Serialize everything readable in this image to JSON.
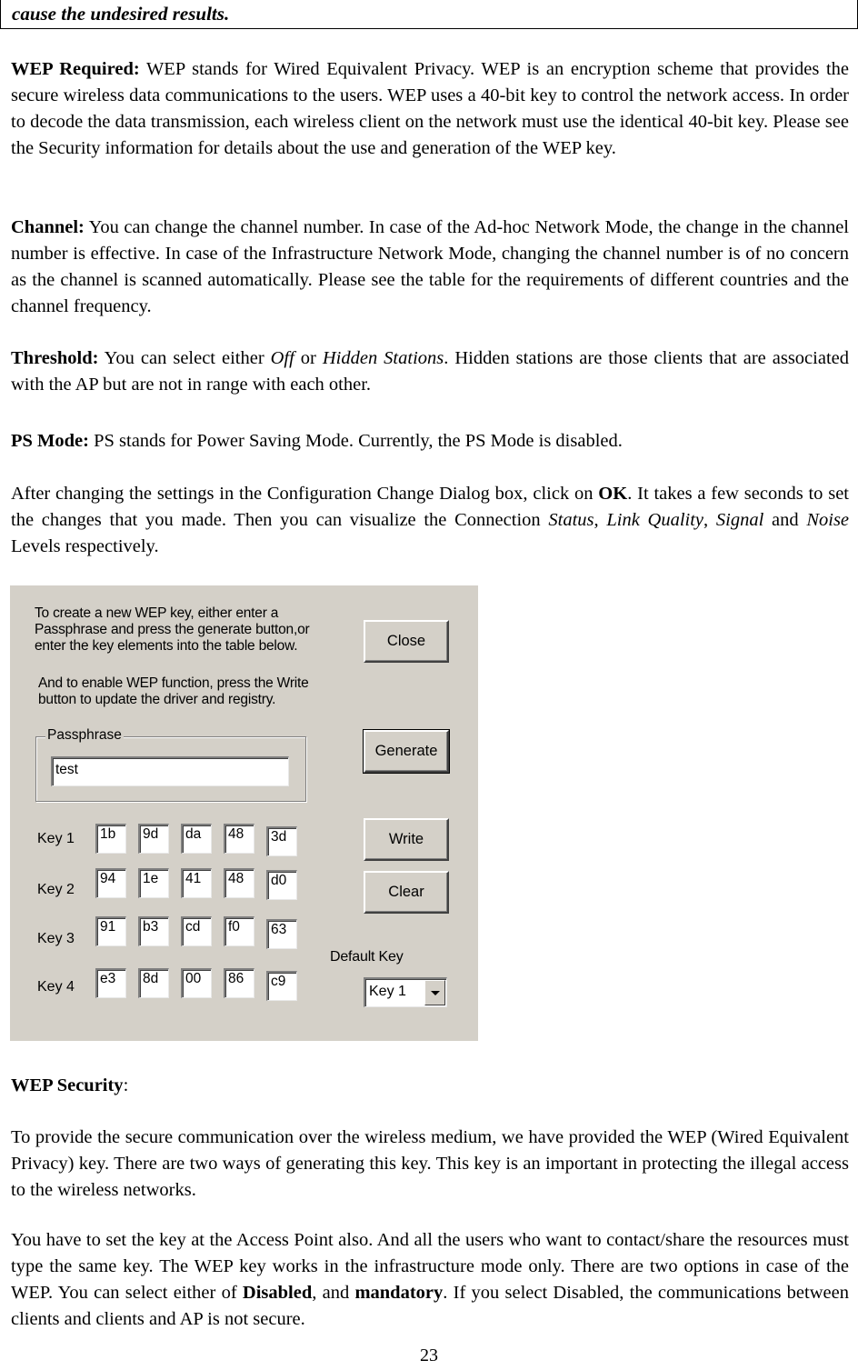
{
  "top_box": {
    "text": "cause the undesired results."
  },
  "sections": {
    "wep_required": {
      "heading": "WEP Required:",
      "text": " WEP stands for Wired Equivalent Privacy. WEP is an encryption scheme that provides the secure wireless data communications to the users. WEP uses a 40-bit key to control the network access. In order to decode the data transmission, each wireless client on the network must use the identical 40-bit key. Please see the Security information for details about the use and generation of the WEP key."
    },
    "channel": {
      "heading": "Channel:",
      "text": " You can change the channel number. In case of the Ad-hoc Network Mode, the change in the channel number is effective. In case of the Infrastructure Network Mode, changing the channel number is of no concern as the channel is scanned automatically. Please see the table for the requirements of different countries and the channel frequency."
    },
    "threshold": {
      "heading": "Threshold:",
      "text_1": " You can select either ",
      "opt_off": "Off",
      "text_2": " or ",
      "opt_hidden": "Hidden Stations",
      "text_3": ". Hidden stations are those clients that are associated with the AP but are not in range with each other."
    },
    "ps_mode": {
      "heading": "PS Mode:",
      "text": " PS stands for Power Saving Mode. Currently, the PS Mode is disabled."
    },
    "after_changing": {
      "text_1": "After changing the settings in the Configuration Change Dialog box, click on ",
      "ok": "OK",
      "text_2": ". It takes a few seconds to set the changes that you made. Then you can visualize the Connection ",
      "status": "Status",
      "sep1": ", ",
      "link_quality": "Link Quality",
      "sep2": ", ",
      "signal": "Signal",
      "text_3": " and ",
      "noise": "Noise",
      "text_4": " Levels respectively."
    },
    "wep_security": {
      "heading": "WEP Security",
      "colon": ":"
    },
    "wep_security_p1": {
      "text": "To provide the secure communication over the wireless medium, we have provided the WEP (Wired Equivalent Privacy) key. There are two ways of generating this key. This key is an important in protecting the illegal access to the wireless networks."
    },
    "wep_security_p2": {
      "text_1": "You have to set the key at the Access Point also. And all the users who want to contact/share the resources must type the same key. The WEP key works in the infrastructure mode only. There are two options in case of the WEP. You can select either of ",
      "disabled": "Disabled",
      "text_2": ", and ",
      "mandatory": "mandatory",
      "text_3": ". If you select Disabled, the communications between clients and clients and AP is not secure."
    }
  },
  "dialog": {
    "instructions_1": [
      "To create a new WEP key, either enter a",
      "Passphrase and press the generate button,or",
      "enter the key elements into the table below."
    ],
    "instructions_2": [
      "And to enable WEP function, press the Write",
      "button to update the driver and registry."
    ],
    "passphrase_label": "Passphrase",
    "passphrase_value": "test",
    "buttons": {
      "close": "Close",
      "generate": "Generate",
      "write": "Write",
      "clear": "Clear"
    },
    "keys": [
      {
        "label": "Key 1",
        "values": [
          "1b",
          "9d",
          "da",
          "48",
          "3d"
        ]
      },
      {
        "label": "Key 2",
        "values": [
          "94",
          "1e",
          "41",
          "48",
          "d0"
        ]
      },
      {
        "label": "Key 3",
        "values": [
          "91",
          "b3",
          "cd",
          "f0",
          "63"
        ]
      },
      {
        "label": "Key 4",
        "values": [
          "e3",
          "8d",
          "00",
          "86",
          "c9"
        ]
      }
    ],
    "default_key_label": "Default Key",
    "default_key_value": "Key 1",
    "colors": {
      "face": "#d4d0c8",
      "field": "#ffffff"
    }
  },
  "page_number": "23"
}
